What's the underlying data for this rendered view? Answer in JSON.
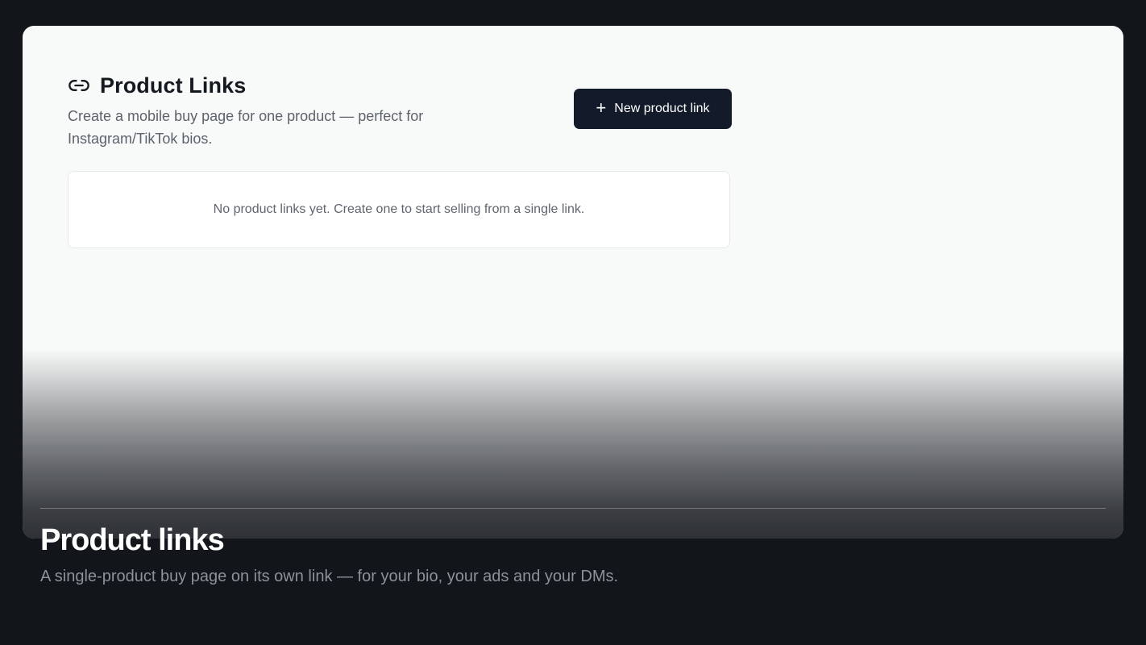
{
  "app": {
    "page_title": "Product Links",
    "page_subtitle": "Create a mobile buy page for one product — perfect for Instagram/TikTok bios.",
    "new_button_label": "New product link",
    "new_button_icon": "plus-icon",
    "title_icon": "link-icon",
    "empty_state_text": "No product links yet. Create one to start selling from a single link."
  },
  "caption": {
    "title": "Product links",
    "description": "A single-product buy page on its own link — for your bio, your ads and your DMs."
  },
  "colors": {
    "background": "#12151a",
    "card": "#f8fafa",
    "button": "#131a2a",
    "title_text": "#14181f"
  }
}
